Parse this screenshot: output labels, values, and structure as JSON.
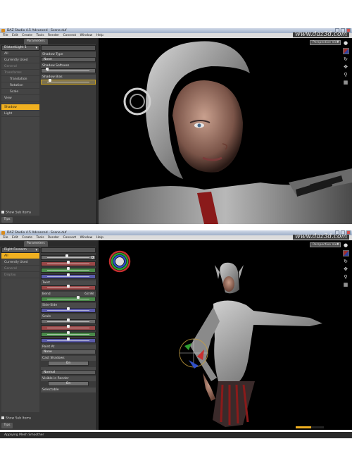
{
  "window": {
    "title": "DAZ Studio 4.5 Advanced - Scene.duf",
    "menu": [
      "File",
      "Edit",
      "Create",
      "Tools",
      "Render",
      "Connect",
      "Window",
      "Help"
    ],
    "logo": "www.daz3d.com"
  },
  "top": {
    "tab_label": "Parameters",
    "node_dropdown": "DistantLight 1",
    "nav": [
      "All",
      "Currently Used",
      "General",
      "Transforms",
      "Translation",
      "Rotation",
      "Scale",
      "View",
      "Shadow",
      "Light"
    ],
    "nav_selected": "Shadow",
    "props": {
      "shadow_type_label": "Shadow Type",
      "shadow_type_value": "None",
      "shadow_softness_label": "Shadow Softness",
      "shadow_bias_label": "Shadow Bias"
    },
    "show_sub_items": "Show Sub Items",
    "bottom_tab": "Tips",
    "view_dropdown": "Perspective View"
  },
  "bottom": {
    "tab_label": "Parameters",
    "node_dropdown": "Right Forearm",
    "nav": [
      "All",
      "Currently Used",
      "General",
      "Display"
    ],
    "nav_selected": "All",
    "props": {
      "twist_label": "Twist",
      "bend_label": "Bend",
      "bend_value": "63.98",
      "side_side_label": "Side-Side",
      "scale_label": "Scale",
      "point_at_label": "Point At",
      "point_at_value": "None",
      "cast_shadows_label": "Cast Shadows",
      "cast_shadows_value": "On",
      "normal_value": "Normal",
      "visible_in_render_label": "Visible in Render",
      "visible_in_render_value": "On",
      "selectable_label": "Selectable"
    },
    "show_sub_items": "Show Sub Items",
    "bottom_tab": "Tips",
    "view_dropdown": "Perspective View",
    "status": "Applying Mesh Smoother",
    "progress": 0.55
  },
  "colors": {
    "accent": "#f0b020",
    "panel": "#3a3a3a",
    "viewport": "#000000"
  },
  "icons": [
    "lock-icon",
    "perspective-cube-icon",
    "rotate-icon",
    "pan-icon",
    "zoom-icon",
    "frame-icon",
    "universal-tool-gizmo-icon"
  ]
}
